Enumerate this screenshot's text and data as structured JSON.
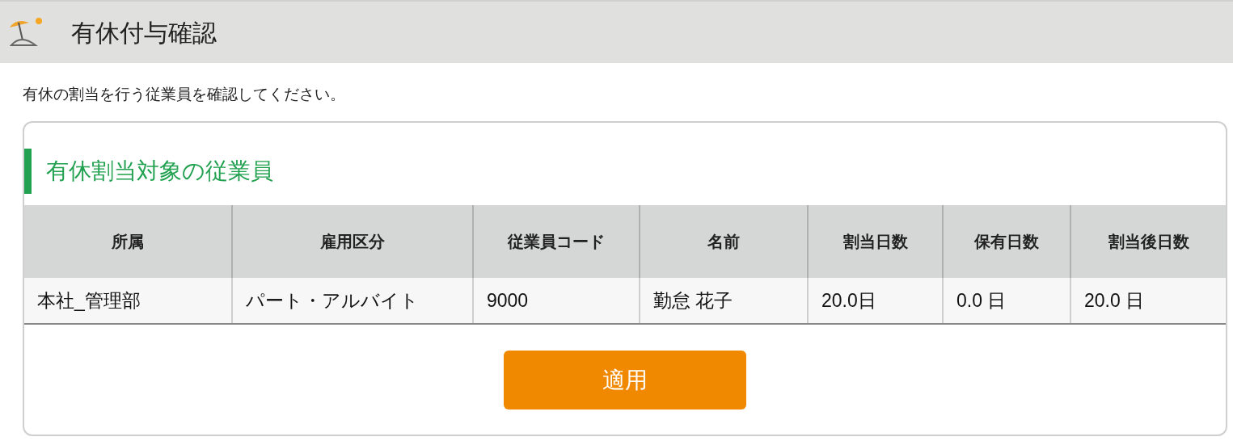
{
  "header": {
    "title": "有休付与確認"
  },
  "instruction": "有休の割当を行う従業員を確認してください。",
  "section": {
    "title": "有休割当対象の従業員"
  },
  "table": {
    "columns": [
      "所属",
      "雇用区分",
      "従業員コード",
      "名前",
      "割当日数",
      "保有日数",
      "割当後日数"
    ],
    "rows": [
      [
        "本社_管理部",
        "パート・アルバイト",
        "9000",
        "勤怠 花子",
        "20.0日",
        "0.0 日",
        "20.0 日"
      ]
    ]
  },
  "apply_button": "適用"
}
